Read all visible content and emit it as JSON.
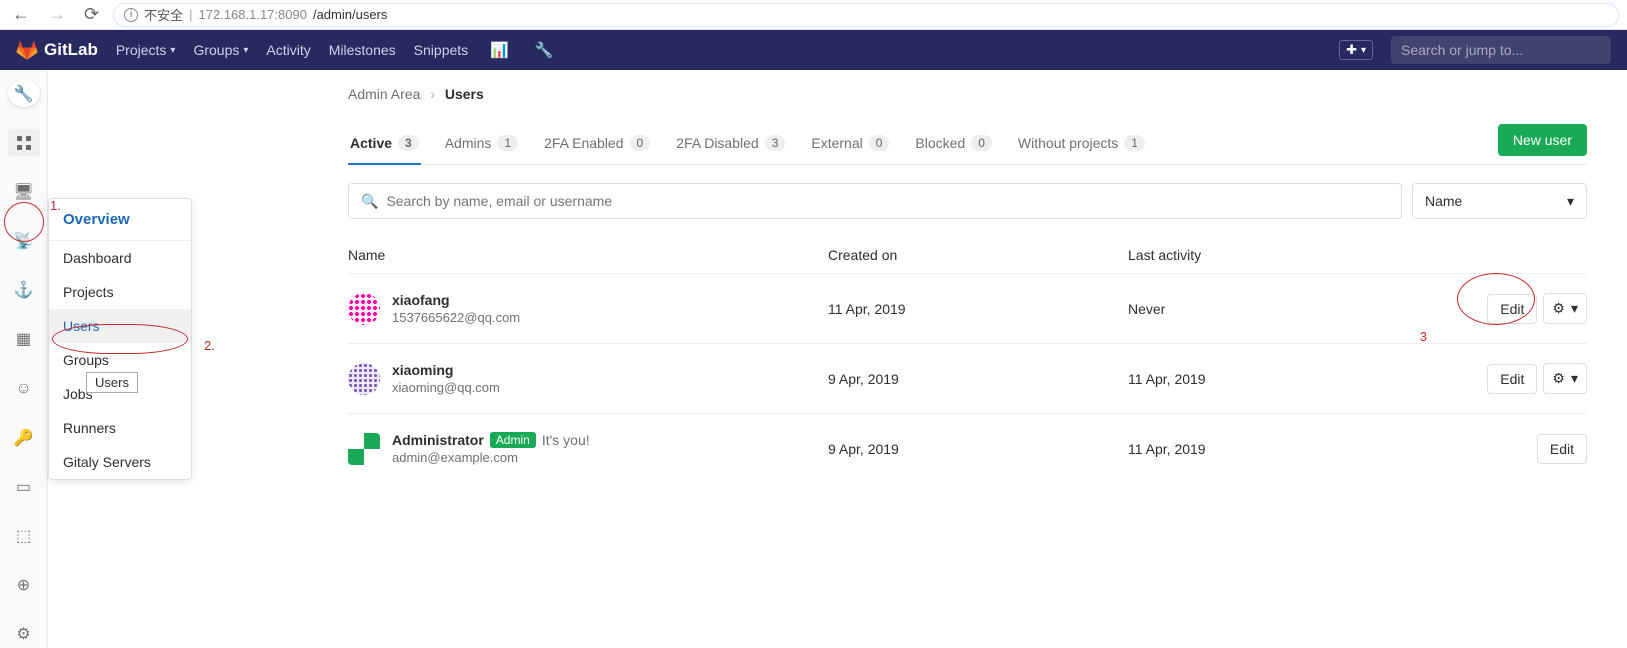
{
  "browser": {
    "insecure_label": "不安全",
    "host": "172.168.1.17",
    "port": ":8090",
    "path": "/admin/users"
  },
  "topnav": {
    "brand": "GitLab",
    "projects": "Projects",
    "groups": "Groups",
    "activity": "Activity",
    "milestones": "Milestones",
    "snippets": "Snippets",
    "search_placeholder": "Search or jump to..."
  },
  "submenu": {
    "header": "Overview",
    "items": [
      "Dashboard",
      "Projects",
      "Users",
      "Groups",
      "Jobs",
      "Runners",
      "Gitaly Servers"
    ],
    "selected": "Users",
    "tooltip": "Users"
  },
  "annotations": {
    "a1": "1.",
    "a2": "2.",
    "a3": "3"
  },
  "breadcrumb": {
    "root": "Admin Area",
    "current": "Users"
  },
  "tabs": [
    {
      "label": "Active",
      "count": "3",
      "active": true
    },
    {
      "label": "Admins",
      "count": "1"
    },
    {
      "label": "2FA Enabled",
      "count": "0"
    },
    {
      "label": "2FA Disabled",
      "count": "3"
    },
    {
      "label": "External",
      "count": "0"
    },
    {
      "label": "Blocked",
      "count": "0"
    },
    {
      "label": "Without projects",
      "count": "1"
    }
  ],
  "new_user_label": "New user",
  "search_placeholder": "Search by name, email or username",
  "sort_label": "Name",
  "columns": {
    "name": "Name",
    "created": "Created on",
    "activity": "Last activity"
  },
  "edit_label": "Edit",
  "users": [
    {
      "name": "xiaofang",
      "email": "1537665622@qq.com",
      "created": "11 Apr, 2019",
      "activity": "Never",
      "avatar": "pink",
      "gear": true
    },
    {
      "name": "xiaoming",
      "email": "xiaoming@qq.com",
      "created": "9 Apr, 2019",
      "activity": "11 Apr, 2019",
      "avatar": "purple",
      "gear": true
    },
    {
      "name": "Administrator",
      "email": "admin@example.com",
      "created": "9 Apr, 2019",
      "activity": "11 Apr, 2019",
      "avatar": "green",
      "gear": false,
      "admin_badge": "Admin",
      "its_you": "It's you!"
    }
  ]
}
